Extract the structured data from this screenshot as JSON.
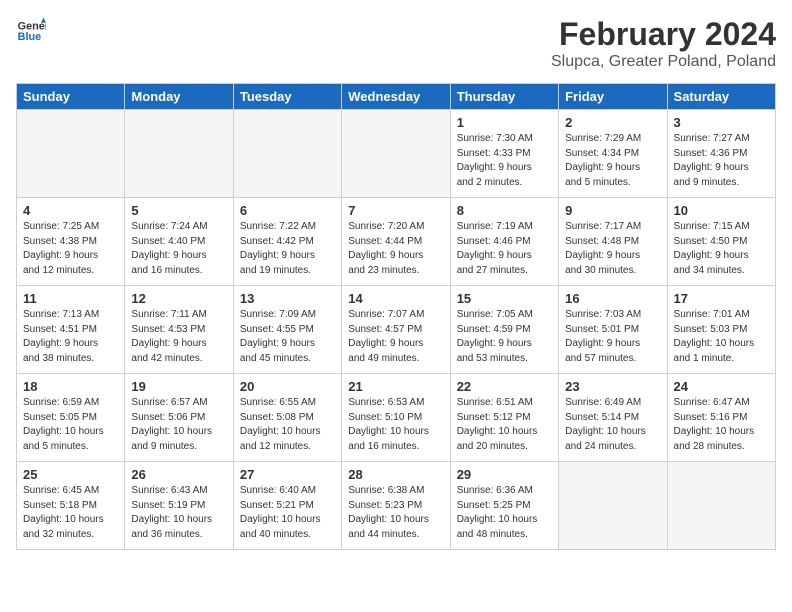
{
  "logo": {
    "line1": "General",
    "line2": "Blue"
  },
  "title": "February 2024",
  "subtitle": "Slupca, Greater Poland, Poland",
  "headers": [
    "Sunday",
    "Monday",
    "Tuesday",
    "Wednesday",
    "Thursday",
    "Friday",
    "Saturday"
  ],
  "weeks": [
    [
      {
        "day": "",
        "info": ""
      },
      {
        "day": "",
        "info": ""
      },
      {
        "day": "",
        "info": ""
      },
      {
        "day": "",
        "info": ""
      },
      {
        "day": "1",
        "info": "Sunrise: 7:30 AM\nSunset: 4:33 PM\nDaylight: 9 hours\nand 2 minutes."
      },
      {
        "day": "2",
        "info": "Sunrise: 7:29 AM\nSunset: 4:34 PM\nDaylight: 9 hours\nand 5 minutes."
      },
      {
        "day": "3",
        "info": "Sunrise: 7:27 AM\nSunset: 4:36 PM\nDaylight: 9 hours\nand 9 minutes."
      }
    ],
    [
      {
        "day": "4",
        "info": "Sunrise: 7:25 AM\nSunset: 4:38 PM\nDaylight: 9 hours\nand 12 minutes."
      },
      {
        "day": "5",
        "info": "Sunrise: 7:24 AM\nSunset: 4:40 PM\nDaylight: 9 hours\nand 16 minutes."
      },
      {
        "day": "6",
        "info": "Sunrise: 7:22 AM\nSunset: 4:42 PM\nDaylight: 9 hours\nand 19 minutes."
      },
      {
        "day": "7",
        "info": "Sunrise: 7:20 AM\nSunset: 4:44 PM\nDaylight: 9 hours\nand 23 minutes."
      },
      {
        "day": "8",
        "info": "Sunrise: 7:19 AM\nSunset: 4:46 PM\nDaylight: 9 hours\nand 27 minutes."
      },
      {
        "day": "9",
        "info": "Sunrise: 7:17 AM\nSunset: 4:48 PM\nDaylight: 9 hours\nand 30 minutes."
      },
      {
        "day": "10",
        "info": "Sunrise: 7:15 AM\nSunset: 4:50 PM\nDaylight: 9 hours\nand 34 minutes."
      }
    ],
    [
      {
        "day": "11",
        "info": "Sunrise: 7:13 AM\nSunset: 4:51 PM\nDaylight: 9 hours\nand 38 minutes."
      },
      {
        "day": "12",
        "info": "Sunrise: 7:11 AM\nSunset: 4:53 PM\nDaylight: 9 hours\nand 42 minutes."
      },
      {
        "day": "13",
        "info": "Sunrise: 7:09 AM\nSunset: 4:55 PM\nDaylight: 9 hours\nand 45 minutes."
      },
      {
        "day": "14",
        "info": "Sunrise: 7:07 AM\nSunset: 4:57 PM\nDaylight: 9 hours\nand 49 minutes."
      },
      {
        "day": "15",
        "info": "Sunrise: 7:05 AM\nSunset: 4:59 PM\nDaylight: 9 hours\nand 53 minutes."
      },
      {
        "day": "16",
        "info": "Sunrise: 7:03 AM\nSunset: 5:01 PM\nDaylight: 9 hours\nand 57 minutes."
      },
      {
        "day": "17",
        "info": "Sunrise: 7:01 AM\nSunset: 5:03 PM\nDaylight: 10 hours\nand 1 minute."
      }
    ],
    [
      {
        "day": "18",
        "info": "Sunrise: 6:59 AM\nSunset: 5:05 PM\nDaylight: 10 hours\nand 5 minutes."
      },
      {
        "day": "19",
        "info": "Sunrise: 6:57 AM\nSunset: 5:06 PM\nDaylight: 10 hours\nand 9 minutes."
      },
      {
        "day": "20",
        "info": "Sunrise: 6:55 AM\nSunset: 5:08 PM\nDaylight: 10 hours\nand 12 minutes."
      },
      {
        "day": "21",
        "info": "Sunrise: 6:53 AM\nSunset: 5:10 PM\nDaylight: 10 hours\nand 16 minutes."
      },
      {
        "day": "22",
        "info": "Sunrise: 6:51 AM\nSunset: 5:12 PM\nDaylight: 10 hours\nand 20 minutes."
      },
      {
        "day": "23",
        "info": "Sunrise: 6:49 AM\nSunset: 5:14 PM\nDaylight: 10 hours\nand 24 minutes."
      },
      {
        "day": "24",
        "info": "Sunrise: 6:47 AM\nSunset: 5:16 PM\nDaylight: 10 hours\nand 28 minutes."
      }
    ],
    [
      {
        "day": "25",
        "info": "Sunrise: 6:45 AM\nSunset: 5:18 PM\nDaylight: 10 hours\nand 32 minutes."
      },
      {
        "day": "26",
        "info": "Sunrise: 6:43 AM\nSunset: 5:19 PM\nDaylight: 10 hours\nand 36 minutes."
      },
      {
        "day": "27",
        "info": "Sunrise: 6:40 AM\nSunset: 5:21 PM\nDaylight: 10 hours\nand 40 minutes."
      },
      {
        "day": "28",
        "info": "Sunrise: 6:38 AM\nSunset: 5:23 PM\nDaylight: 10 hours\nand 44 minutes."
      },
      {
        "day": "29",
        "info": "Sunrise: 6:36 AM\nSunset: 5:25 PM\nDaylight: 10 hours\nand 48 minutes."
      },
      {
        "day": "",
        "info": ""
      },
      {
        "day": "",
        "info": ""
      }
    ]
  ]
}
